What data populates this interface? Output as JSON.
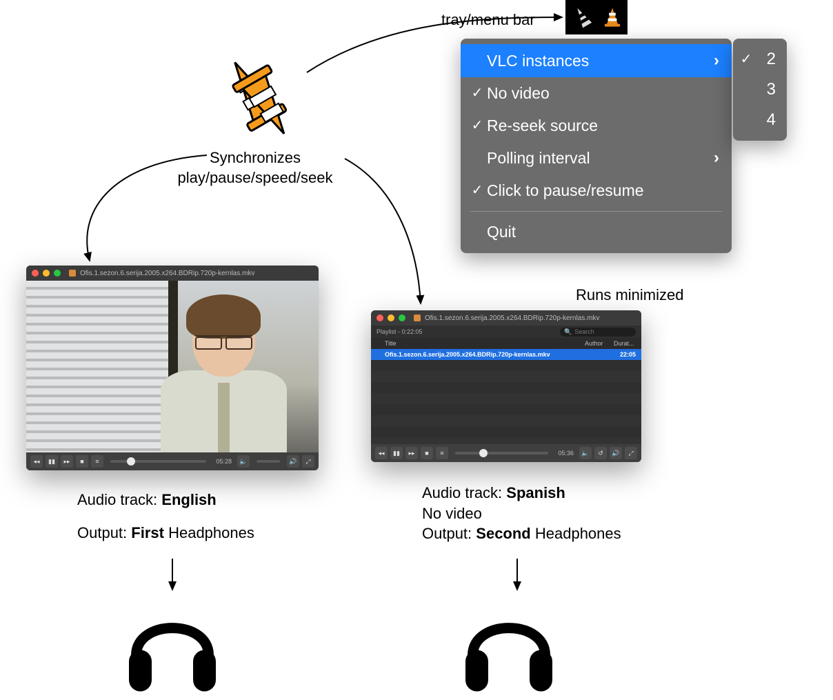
{
  "tray": {
    "label": "tray/menu bar"
  },
  "sync_text_line1": "Synchronizes",
  "sync_text_line2": "play/pause/speed/seek",
  "runs_minimized": "Runs minimized",
  "menu": {
    "items": [
      {
        "label": "VLC instances",
        "checked": false,
        "submenu": true,
        "highlighted": true
      },
      {
        "label": "No video",
        "checked": true
      },
      {
        "label": "Re-seek source",
        "checked": true
      },
      {
        "label": "Polling interval",
        "checked": false,
        "submenu": true
      },
      {
        "label": "Click to pause/resume",
        "checked": true
      }
    ],
    "quit": "Quit"
  },
  "submenu": {
    "options": [
      {
        "value": "2",
        "checked": true
      },
      {
        "value": "3",
        "checked": false
      },
      {
        "value": "4",
        "checked": false
      }
    ]
  },
  "vlc_left": {
    "title": "Ofis.1.sezon.6.serija.2005.x264.BDRip.720p-kernlas.mkv",
    "time": "05:28",
    "knob_pct": 17
  },
  "vlc_right": {
    "title": "Ofis.1.sezon.6.serija.2005.x264.BDRip.720p-kernlas.mkv",
    "playlist_header": "Playlist - 0:22:05",
    "search_placeholder": "Search",
    "columns": {
      "title": "Title",
      "author": "Author",
      "duration": "Durat..."
    },
    "row": {
      "title": "Ofis.1.sezon.6.serija.2005.x264.BDRip.720p-kernlas.mkv",
      "duration": "22:05"
    },
    "time": "05:36",
    "knob_pct": 26
  },
  "captions": {
    "left": {
      "track_label": "Audio track: ",
      "track_value": "English",
      "output_label": "Output: ",
      "output_strong": "First",
      "output_rest": " Headphones"
    },
    "right": {
      "track_label": "Audio track: ",
      "track_value": "Spanish",
      "novideo": "No video",
      "output_label": "Output: ",
      "output_strong": "Second",
      "output_rest": " Headphones"
    }
  }
}
